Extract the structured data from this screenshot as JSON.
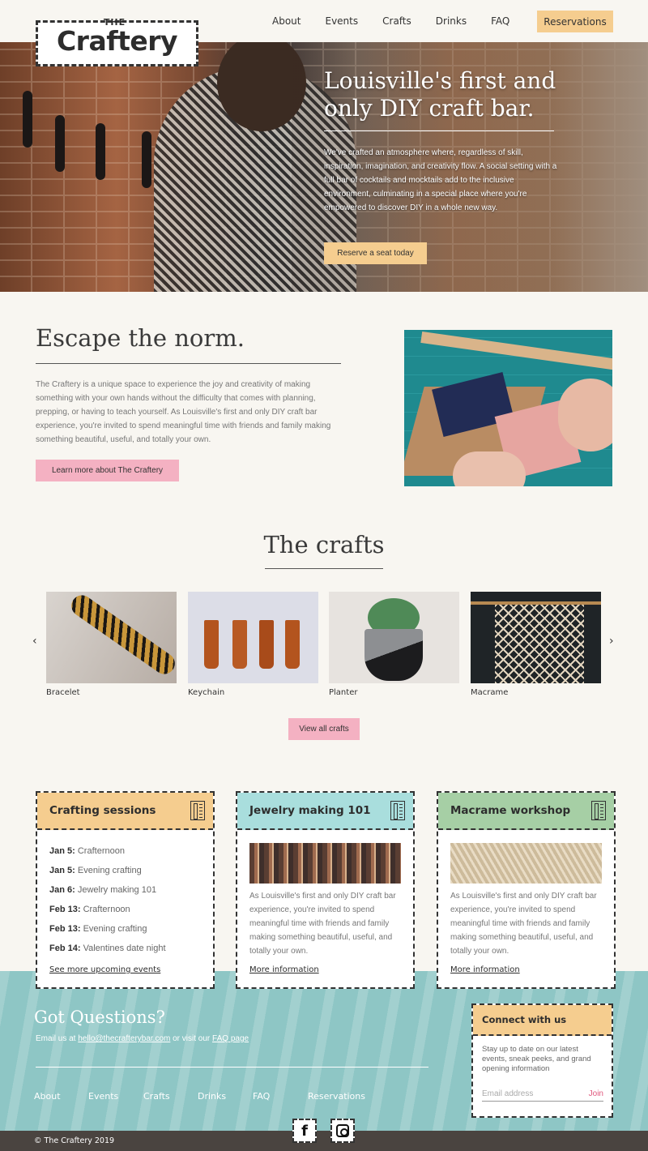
{
  "logo": {
    "top": "THE",
    "name": "Craftery"
  },
  "nav": {
    "items": [
      "About",
      "Events",
      "Crafts",
      "Drinks",
      "FAQ"
    ],
    "cta": "Reservations"
  },
  "hero": {
    "title": "Louisville's first and only DIY craft bar.",
    "body": "We've crafted an atmosphere where, regardless of skill, inspiration, imagination, and creativity flow. A social setting with a full bar of cocktails and mocktails add to the inclusive environment, culminating in a special place where you're empowered to discover DIY in a whole new way.",
    "button": "Reserve a seat today"
  },
  "escape": {
    "title": "Escape the norm.",
    "body": "The Craftery is a unique space to experience the joy and creativity of making something with your own hands without the difficulty that comes with planning, prepping, or having to teach yourself. As Louisville's first and only DIY craft bar experience, you're invited to spend meaningful time with friends and family making something beautiful, useful, and totally your own.",
    "button": "Learn more about The Craftery"
  },
  "crafts": {
    "title": "The crafts",
    "items": [
      "Bracelet",
      "Keychain",
      "Planter",
      "Macrame"
    ],
    "prev": "‹",
    "next": "›",
    "button": "View all crafts"
  },
  "cards": {
    "sessions": {
      "title": "Crafting sessions",
      "color": "#f5cd8f",
      "events": [
        {
          "date": "Jan 5:",
          "name": "Crafternoon"
        },
        {
          "date": "Jan 5:",
          "name": "Evening crafting"
        },
        {
          "date": "Jan 6:",
          "name": "Jewelry making 101"
        },
        {
          "date": "Feb 13:",
          "name": "Crafternoon"
        },
        {
          "date": "Feb 13:",
          "name": "Evening crafting"
        },
        {
          "date": "Feb 14:",
          "name": "Valentines date night"
        }
      ],
      "link": "See more upcoming events"
    },
    "jewelry": {
      "title": "Jewelry making 101",
      "color": "#a9dedd",
      "body": "As Louisville's first and only DIY craft bar experience, you're invited to spend meaningful time with friends and family making something beautiful, useful, and totally your own.",
      "link": "More information"
    },
    "macrame": {
      "title": "Macrame workshop",
      "color": "#a6cfa5",
      "body": "As Louisville's first and only DIY craft bar experience, you're invited to spend meaningful time with friends and family making something beautiful, useful, and totally your own.",
      "link": "More information"
    }
  },
  "footer": {
    "questions_title": "Got Questions?",
    "email_prefix": "Email us at ",
    "email": "hello@thecrafterybar.com",
    "visit": " or visit our ",
    "faq_link": "FAQ page",
    "nav": [
      "About",
      "Events",
      "Crafts",
      "Drinks",
      "FAQ",
      "Reservations"
    ],
    "connect_title": "Connect with us",
    "connect_body": "Stay up to date on our latest events, sneak peeks, and grand opening information",
    "email_placeholder": "Email address",
    "join": "Join",
    "facebook": "f",
    "copyright": "© The Craftery 2019"
  }
}
